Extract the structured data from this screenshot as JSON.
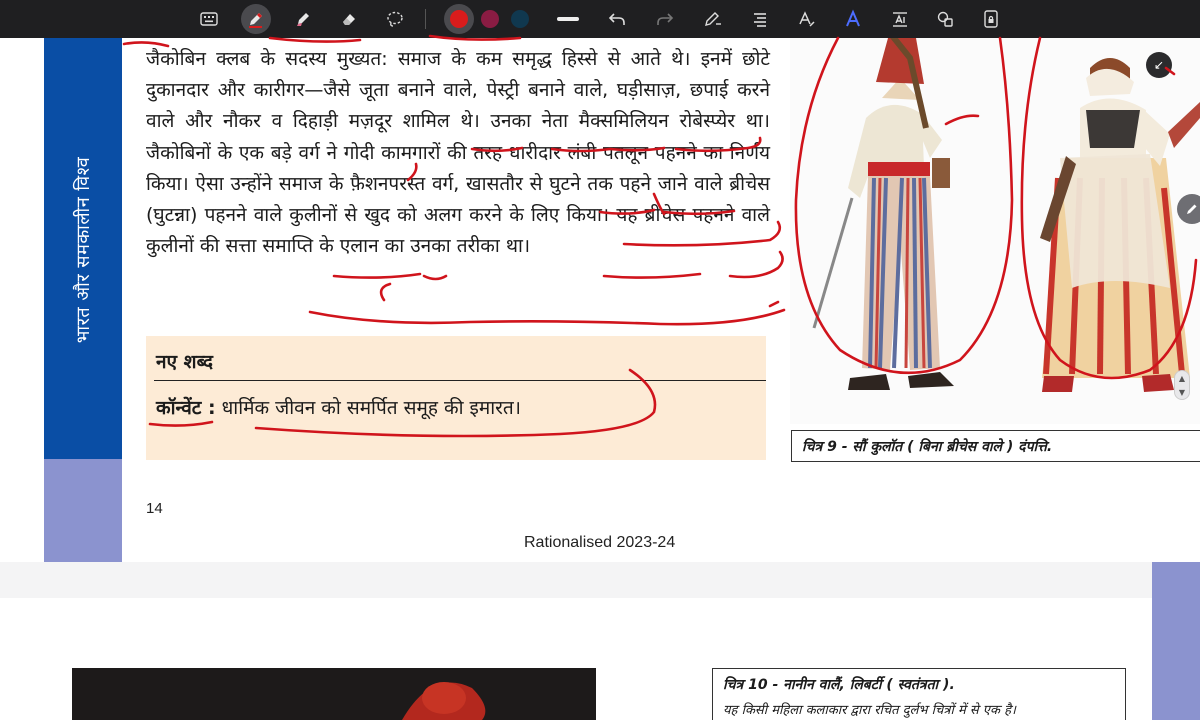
{
  "toolbar": {
    "tools": [
      {
        "name": "keyboard"
      },
      {
        "name": "pen",
        "active": true
      },
      {
        "name": "highlighter"
      },
      {
        "name": "eraser"
      },
      {
        "name": "lasso"
      }
    ],
    "colors": [
      "#d91c1c",
      "#8a1c43",
      "#10384f"
    ],
    "selected_color": "#d91c1c"
  },
  "page": {
    "side_title": "भारत और समकालीन विश्व",
    "paragraph": "जैकोबिन क्लब के सदस्य मुख्यत: समाज के कम समृद्ध हिस्से से आते थे। इनमें छोटे दुकानदार और कारीगर—जैसे जूता बनाने वाले, पेस्ट्री बनाने वाले, घड़ीसाज़, छपाई करने वाले और नौकर व दिहाड़ी मज़दूर शामिल थे। उनका नेता मैक्समिलियन रोबेस्प्येर था। जैकोबिनों के एक बड़े वर्ग ने गोदी कामगारों की तरह धारीदार लंबी पतलून पहनने का निर्णय किया। ऐसा उन्होंने समाज के फ़ैशनपरस्त वर्ग, खासतौर से घुटने तक पहने जाने वाले ब्रीचेस (घुटन्ना) पहनने वाले कुलीनों से खुद को अलग करने के लिए किया। यह ब्रीचेस पहनने वाले कुलीनों की सत्ता समाप्ति के एलान का उनका तरीका था।",
    "new_words": {
      "title": "नए शब्द",
      "term": "कॉन्वेंट :",
      "definition": "धार्मिक जीवन को समर्पित समूह की इमारत।"
    },
    "page_number": "14",
    "footer": "Rationalised 2023-24",
    "figure_caption": "चित्र 9 - सौं कुलॉत ( बिना ब्रीचेस वाले ) दंपत्ति."
  },
  "next_page": {
    "caption_title": "चित्र 10 - नानीन वालैं, लिबर्टी ( स्वतंत्रता ).",
    "caption_text": "यह किसी महिला कलाकार द्वारा रचित दुर्लभ चित्रों में से एक है।"
  }
}
